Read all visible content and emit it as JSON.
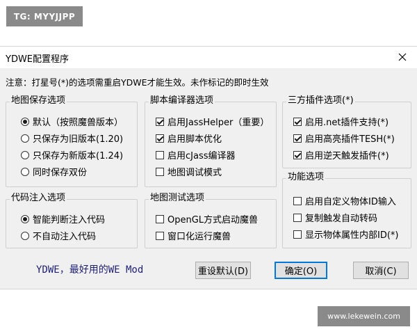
{
  "watermark_top": "TG: MYYJJPP",
  "watermark_bottom": "www.lekewein.com",
  "window": {
    "title": "YDWE配置程序",
    "close_icon": "close-icon"
  },
  "notice": "注意：打星号(*)的选项需重启YDWE才能生效。未作标记的即时生效",
  "groups": {
    "map_save": {
      "title": "地图保存选项",
      "options": [
        {
          "label": "默认（按照魔兽版本）",
          "checked": true
        },
        {
          "label": "只保存为旧版本(1.20)",
          "checked": false
        },
        {
          "label": "只保存为新版本(1.24)",
          "checked": false
        },
        {
          "label": "同时保存双份",
          "checked": false
        }
      ]
    },
    "code_inject": {
      "title": "代码注入选项",
      "options": [
        {
          "label": "智能判断注入代码",
          "checked": true
        },
        {
          "label": "不自动注入代码",
          "checked": false
        }
      ]
    },
    "script_compiler": {
      "title": "脚本编译器选项",
      "options": [
        {
          "label": "启用JassHelper（重要）",
          "checked": true
        },
        {
          "label": "启用脚本优化",
          "checked": true
        },
        {
          "label": "启用cJass编译器",
          "checked": false
        },
        {
          "label": "地图调试模式",
          "checked": false
        }
      ]
    },
    "map_test": {
      "title": "地图测试选项",
      "options": [
        {
          "label": "OpenGL方式启动魔兽",
          "checked": false
        },
        {
          "label": "窗口化运行魔兽",
          "checked": false
        }
      ]
    },
    "third_party": {
      "title": "三方插件选项(*)",
      "options": [
        {
          "label": "启用.net插件支持(*)",
          "checked": true
        },
        {
          "label": "启用高亮插件TESH(*)",
          "checked": true
        },
        {
          "label": "启用逆天触发插件(*)",
          "checked": true
        }
      ]
    },
    "features": {
      "title": "功能选项",
      "options": [
        {
          "label": "启用自定义物体ID输入",
          "checked": false
        },
        {
          "label": "复制触发自动转码",
          "checked": false
        },
        {
          "label": "显示物体属性内部ID(*)",
          "checked": false
        }
      ]
    }
  },
  "footer_text": "YDWE，最好用的WE Mod",
  "buttons": {
    "reset": "重设默认(D)",
    "ok": "确定(O)",
    "cancel": "取消(C)"
  },
  "colors": {
    "dialog_bg": "#f0f0f0",
    "watermark_bg": "#8a8a8a",
    "default_button_border": "#0078d7",
    "footer_text": "#1f1f7a"
  }
}
